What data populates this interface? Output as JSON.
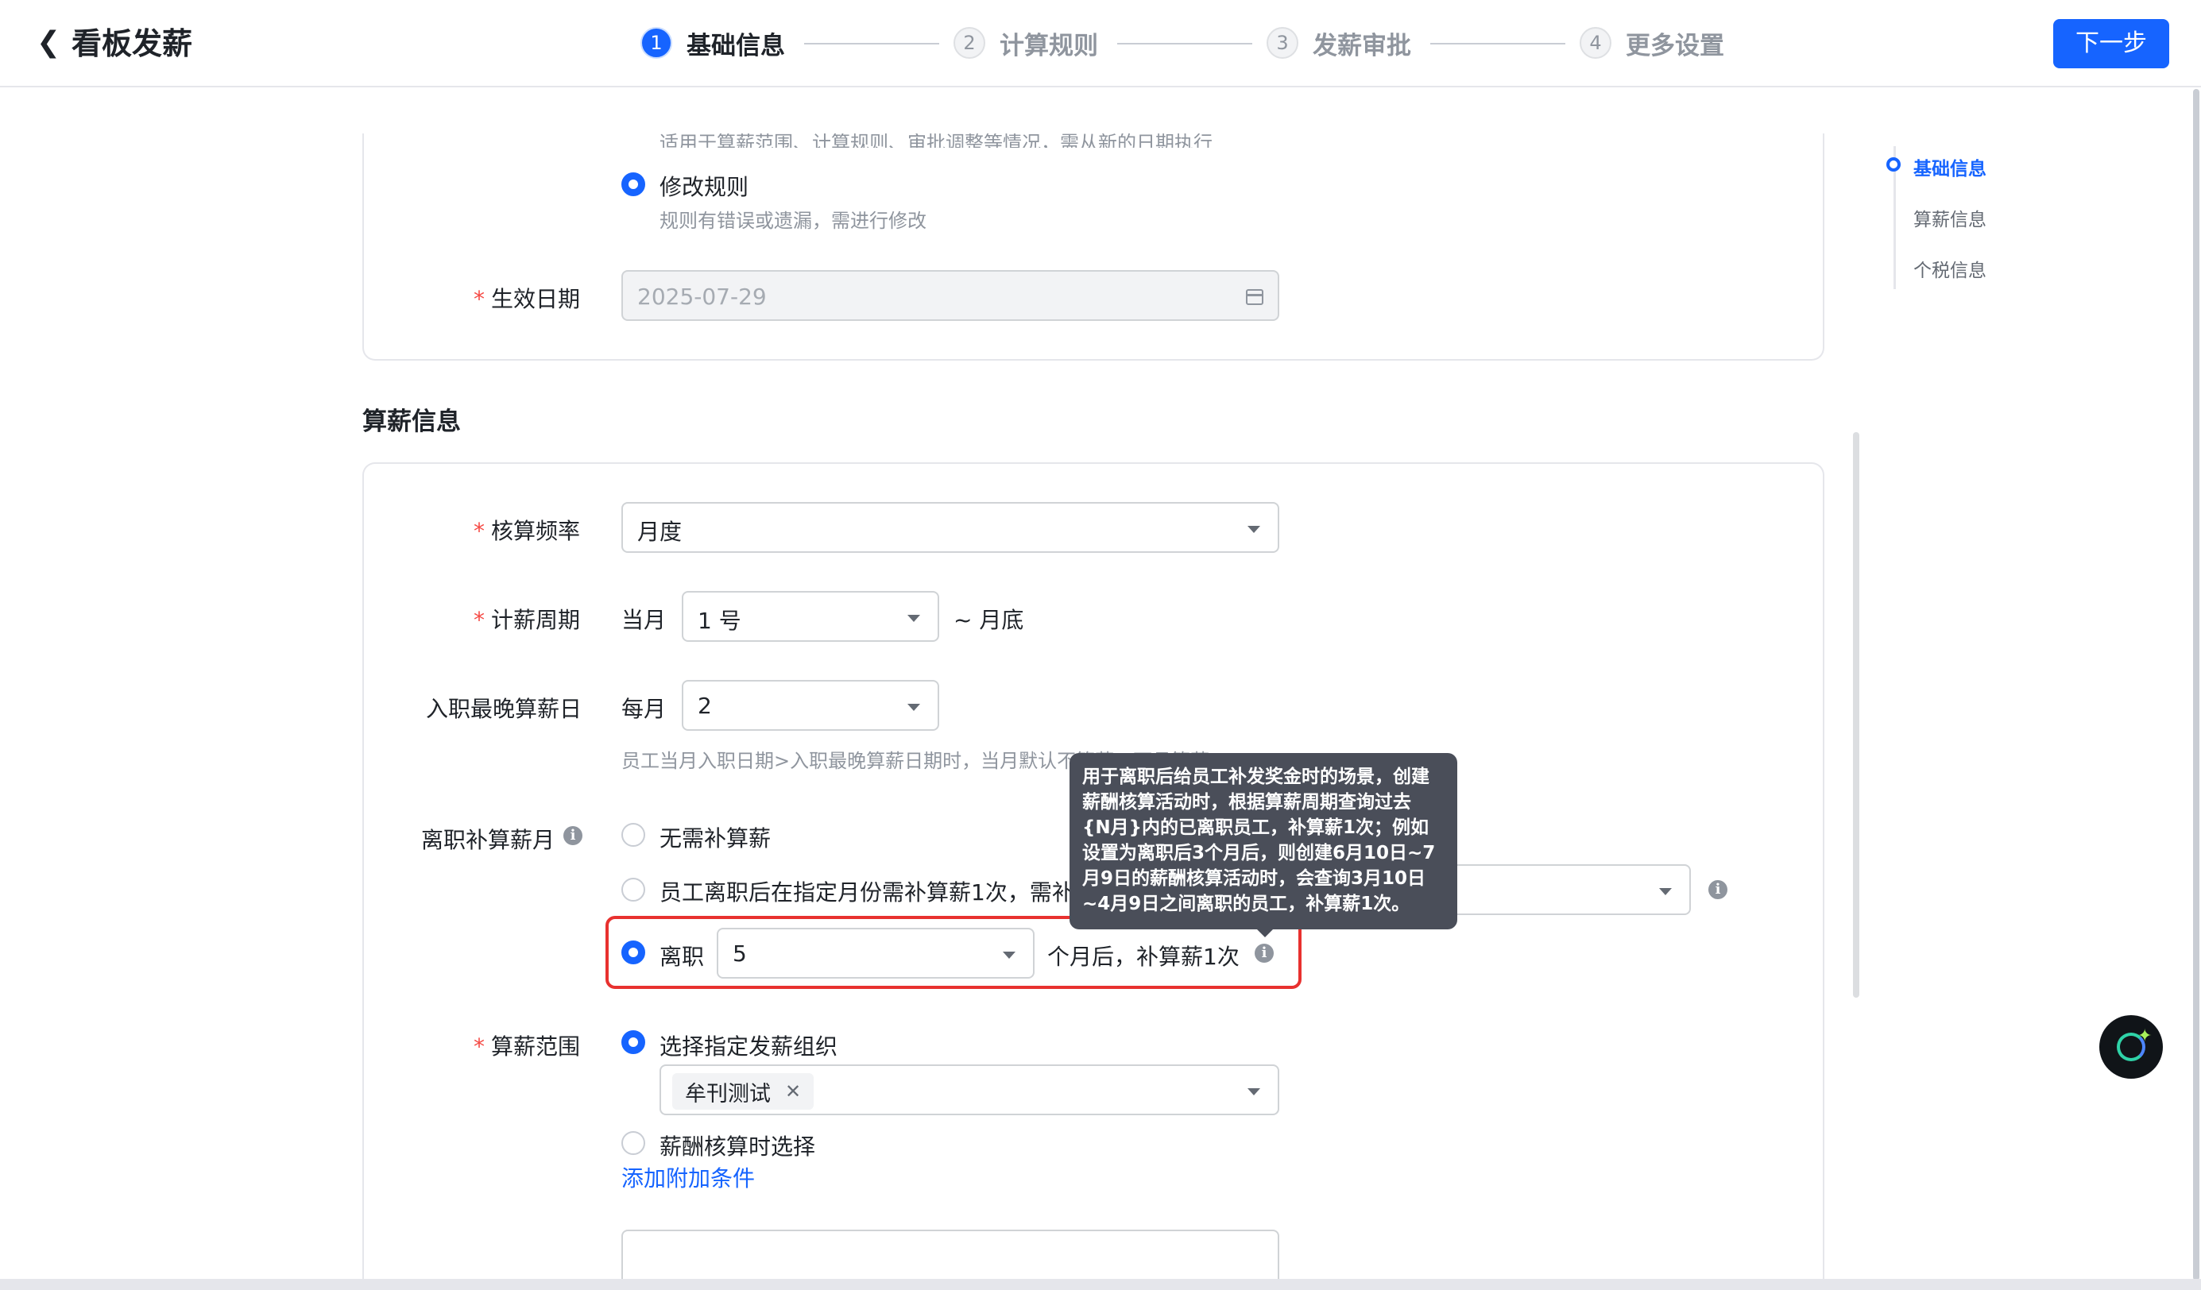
{
  "header": {
    "title": "看板发薪",
    "next_label": "下一步",
    "steps": [
      {
        "num": "1",
        "label": "基础信息"
      },
      {
        "num": "2",
        "label": "计算规则"
      },
      {
        "num": "3",
        "label": "发薪审批"
      },
      {
        "num": "4",
        "label": "更多设置"
      }
    ]
  },
  "rule_section": {
    "cut_text": "适用于算薪范围、计算规则、审批调整等情况，需从新的日期执行",
    "modify_label": "修改规则",
    "modify_desc": "规则有错误或遗漏，需进行修改",
    "effective_label": "生效日期",
    "effective_value": "2025-07-29"
  },
  "payroll": {
    "title": "算薪信息",
    "frequency_label": "核算频率",
    "frequency_value": "月度",
    "period_label": "计薪周期",
    "period_prefix": "当月",
    "period_value": "1 号",
    "period_suffix": "~ 月底",
    "latest_join_label": "入职最晚算薪日",
    "latest_join_prefix": "每月",
    "latest_join_value": "2",
    "latest_join_hint": "员工当月入职日期>入职最晚算薪日期时，当月默认不算薪，下月算薪",
    "resign_label": "离职补算薪月",
    "resign_opt1": "无需补算薪",
    "resign_opt2": "员工离职后在指定月份需补算薪1次，需补",
    "resign_opt3_prefix": "离职",
    "resign_opt3_value": "5",
    "resign_opt3_suffix": "个月后，补算薪1次",
    "scope_label": "算薪范围",
    "scope_opt1": "选择指定发薪组织",
    "scope_tag": "牟刊测试",
    "scope_opt2": "薪酬核算时选择",
    "add_condition": "添加附加条件"
  },
  "tooltip": {
    "lines": [
      "用于离职后给员工补发奖金时的场景，创建",
      "薪酬核算活动时，根据算薪周期查询过去",
      "{N月}内的已离职员工，补算薪1次；例如",
      "设置为离职后3个月后，则创建6月10日~7",
      "月9日的薪酬核算活动时，会查询3月10日",
      "~4月9日之间离职的员工，补算薪1次。"
    ]
  },
  "anchors": [
    "基础信息",
    "算薪信息",
    "个税信息"
  ],
  "colors": {
    "primary": "#1664ff",
    "highlight": "#e8312f",
    "required": "#f54a45"
  }
}
